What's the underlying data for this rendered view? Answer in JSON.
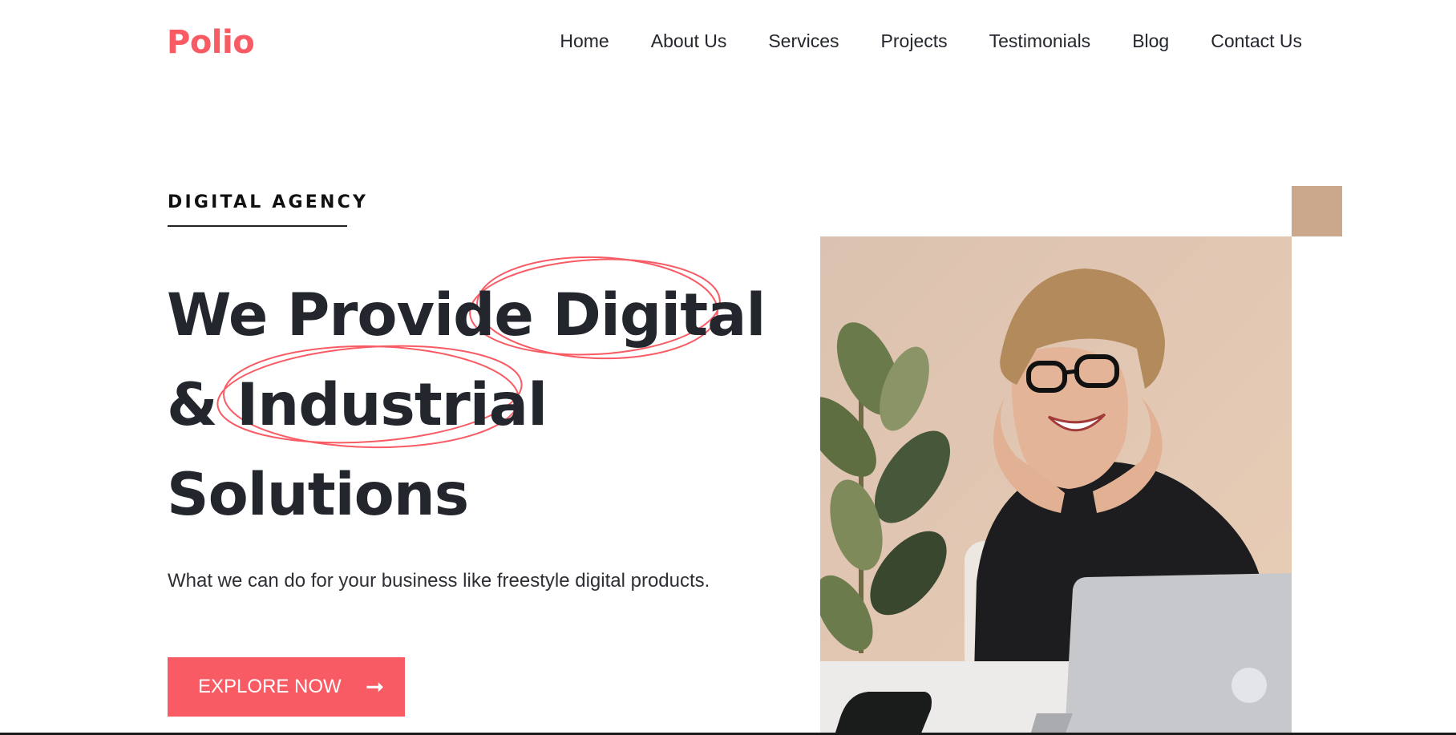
{
  "brand": {
    "logo_text": "Polio",
    "accent_color": "#f85b64",
    "secondary_accent": "#cba88c"
  },
  "nav": {
    "items": [
      "Home",
      "About Us",
      "Services",
      "Projects",
      "Testimonials",
      "Blog",
      "Contact Us"
    ]
  },
  "hero": {
    "eyebrow": "DIGITAL AGENCY",
    "title_line1_a": "We Provide ",
    "title_line1_b": "Digital",
    "title_line2_a": "& ",
    "title_line2_b": "Industrial",
    "title_line3": "Solutions",
    "subtitle": "What we can do for your business like freestyle digital products.",
    "cta_label": "EXPLORE NOW",
    "cta_icon": "arrow-right-icon",
    "image_subject": "smiling woman with glasses at desk with laptop and plant"
  }
}
